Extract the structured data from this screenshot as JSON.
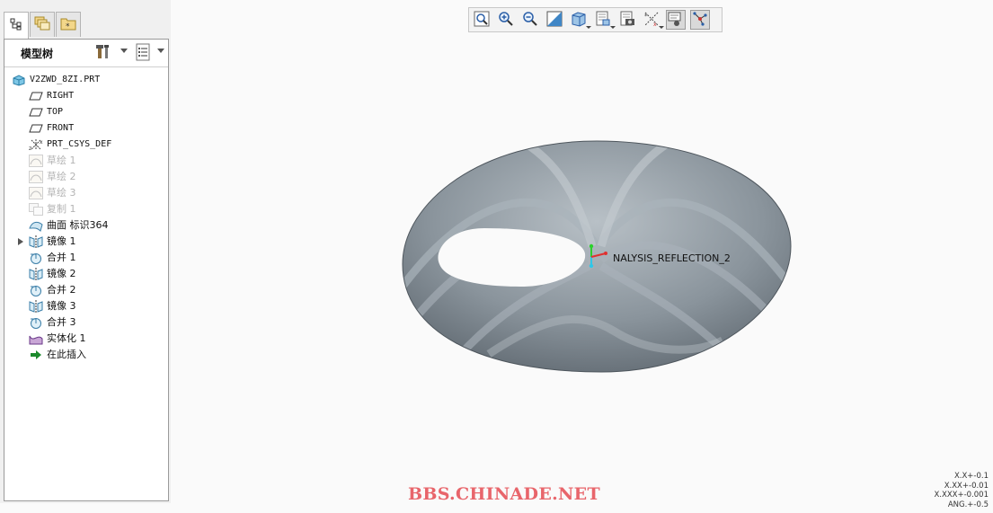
{
  "model_tree": {
    "title": "模型树",
    "items": [
      {
        "label": "V2ZWD_8ZI.PRT",
        "icon": "part-icon",
        "level": 0,
        "muted": false,
        "expandable": false
      },
      {
        "label": "RIGHT",
        "icon": "datum-plane-icon",
        "level": 1,
        "muted": false,
        "expandable": false
      },
      {
        "label": "TOP",
        "icon": "datum-plane-icon",
        "level": 1,
        "muted": false,
        "expandable": false
      },
      {
        "label": "FRONT",
        "icon": "datum-plane-icon",
        "level": 1,
        "muted": false,
        "expandable": false
      },
      {
        "label": "PRT_CSYS_DEF",
        "icon": "coordinate-system-icon",
        "level": 1,
        "muted": false,
        "expandable": false
      },
      {
        "label": "草绘 1",
        "icon": "sketch-icon",
        "level": 1,
        "muted": true,
        "expandable": false
      },
      {
        "label": "草绘 2",
        "icon": "sketch-icon",
        "level": 1,
        "muted": true,
        "expandable": false
      },
      {
        "label": "草绘 3",
        "icon": "sketch-icon",
        "level": 1,
        "muted": true,
        "expandable": false
      },
      {
        "label": "复制 1",
        "icon": "copy-icon",
        "level": 1,
        "muted": true,
        "expandable": false
      },
      {
        "label": "曲面 标识364",
        "icon": "surface-icon",
        "level": 1,
        "muted": false,
        "expandable": false
      },
      {
        "label": "镜像 1",
        "icon": "mirror-icon",
        "level": 1,
        "muted": false,
        "expandable": true
      },
      {
        "label": "合并 1",
        "icon": "merge-icon",
        "level": 1,
        "muted": false,
        "expandable": false
      },
      {
        "label": "镜像 2",
        "icon": "mirror-icon",
        "level": 1,
        "muted": false,
        "expandable": false
      },
      {
        "label": "合并 2",
        "icon": "merge-icon",
        "level": 1,
        "muted": false,
        "expandable": false
      },
      {
        "label": "镜像 3",
        "icon": "mirror-icon",
        "level": 1,
        "muted": false,
        "expandable": false
      },
      {
        "label": "合并 3",
        "icon": "merge-icon",
        "level": 1,
        "muted": false,
        "expandable": false
      },
      {
        "label": "实体化 1",
        "icon": "solidify-icon",
        "level": 1,
        "muted": false,
        "expandable": false
      },
      {
        "label": "在此插入",
        "icon": "insert-here-arrow-icon",
        "level": 1,
        "muted": false,
        "expandable": false
      }
    ]
  },
  "panel_tabs": [
    {
      "icon": "model-tree-tab-icon",
      "active": true
    },
    {
      "icon": "folder-browser-tab-icon",
      "active": false
    },
    {
      "icon": "favorites-tab-icon",
      "active": false
    }
  ],
  "header_tools": [
    {
      "icon": "tree-settings-tools-icon"
    },
    {
      "icon": "show-columns-icon"
    }
  ],
  "toolbar": [
    {
      "icon": "refit-icon",
      "pressed": false,
      "dropdown": false
    },
    {
      "icon": "zoom-in-icon",
      "pressed": false,
      "dropdown": false
    },
    {
      "icon": "zoom-out-icon",
      "pressed": false,
      "dropdown": false
    },
    {
      "icon": "repaint-icon",
      "pressed": false,
      "dropdown": false
    },
    {
      "icon": "display-style-icon",
      "pressed": false,
      "dropdown": true
    },
    {
      "icon": "saved-views-icon",
      "pressed": false,
      "dropdown": true
    },
    {
      "icon": "view-manager-icon",
      "pressed": false,
      "dropdown": false
    },
    {
      "icon": "datum-display-icon",
      "pressed": false,
      "dropdown": true
    },
    {
      "icon": "annotation-display-icon",
      "pressed": true,
      "dropdown": false
    },
    {
      "icon": "spin-center-icon",
      "pressed": true,
      "dropdown": false
    }
  ],
  "viewport": {
    "model_label": "NALYSIS_REFLECTION_2",
    "model_color": "#7d8790",
    "stripe_color": "#aab3ba"
  },
  "watermark": "BBS.CHINADE.NET",
  "watermark_color": "#e8656b",
  "tolerances": [
    "X.X+-0.1",
    "X.XX+-0.01",
    "X.XXX+-0.001",
    "ANG.+-0.5"
  ]
}
